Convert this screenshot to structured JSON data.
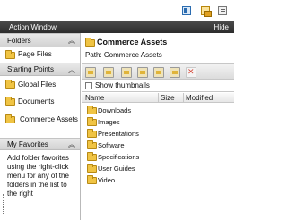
{
  "top_icons": [
    "window-layout-icon",
    "asset-folder-icon",
    "notes-icon"
  ],
  "window": {
    "title": "Action Window",
    "hide_label": "Hide"
  },
  "sections": {
    "folders": {
      "label": "Folders",
      "items": [
        {
          "label": "Page Files"
        }
      ]
    },
    "starting_points": {
      "label": "Starting Points",
      "items": [
        {
          "label": "Global Files"
        },
        {
          "label": "Documents"
        },
        {
          "label": "Commerce Assets"
        }
      ]
    },
    "favorites": {
      "label": "My Favorites",
      "hint": "Add folder favorites using the right-click menu for any of the folders in the list to the right"
    }
  },
  "main": {
    "title": "Commerce Assets",
    "path_label": "Path: Commerce Assets",
    "toolbar": [
      "new-folder-icon",
      "upload-icon",
      "download-icon",
      "copy-icon",
      "move-icon",
      "rename-icon",
      "delete-icon"
    ],
    "show_thumbnails_label": "Show thumbnails",
    "show_thumbnails_checked": false,
    "columns": {
      "name": "Name",
      "size": "Size",
      "modified": "Modified"
    },
    "files": [
      {
        "name": "Downloads"
      },
      {
        "name": "Images"
      },
      {
        "name": "Presentations"
      },
      {
        "name": "Software"
      },
      {
        "name": "Specifications"
      },
      {
        "name": "User Guides"
      },
      {
        "name": "Video"
      }
    ]
  },
  "colors": {
    "title_bar": "#3a3a3a",
    "section_header": "#dcdcdc",
    "folder": "#f0c444"
  }
}
